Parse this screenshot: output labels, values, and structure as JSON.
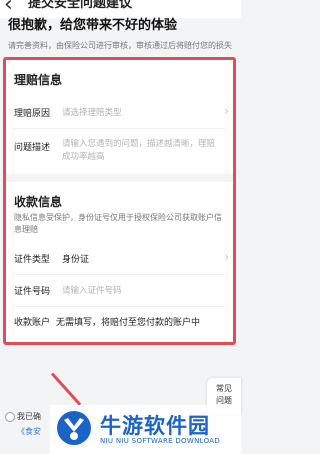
{
  "header": {
    "title_cut": "提交安全问题建议"
  },
  "intro": {
    "headline": "很抱歉，给您带来不好的体验",
    "subtext": "请完善资料，由保险公司进行审核，审核通过后将赔付您的损失"
  },
  "claim": {
    "section_title": "理赔信息",
    "reason_label": "理赔原因",
    "reason_placeholder": "请选择理赔类型",
    "problem_label": "问题描述",
    "problem_placeholder_line1": "请输入您遇到的问题，描述越清晰，理赔",
    "problem_placeholder_line2": "成功率越高"
  },
  "payment": {
    "section_title": "收款信息",
    "privacy_note": "隐私信息受保护，身份证号仅用于授权保险公司获取账户信息理赔",
    "id_type_label": "证件类型",
    "id_type_value": "身份证",
    "id_number_label": "证件号码",
    "id_number_placeholder": "请输入证件号码",
    "account_label": "收款账户",
    "account_value": "无需填写，将赔付至您付款的账户中"
  },
  "footer": {
    "agree_text": "我已确",
    "agree_link": "《食安",
    "faq_line1": "常见",
    "faq_line2": "问题"
  },
  "watermark": {
    "title": "牛游软件园",
    "subtitle": "NIU NIU SOFTWARE DOWNLOAD"
  },
  "colors": {
    "highlight_border": "#e14c5a",
    "link": "#3a78e7",
    "watermark_blue": "#1a63c7"
  }
}
